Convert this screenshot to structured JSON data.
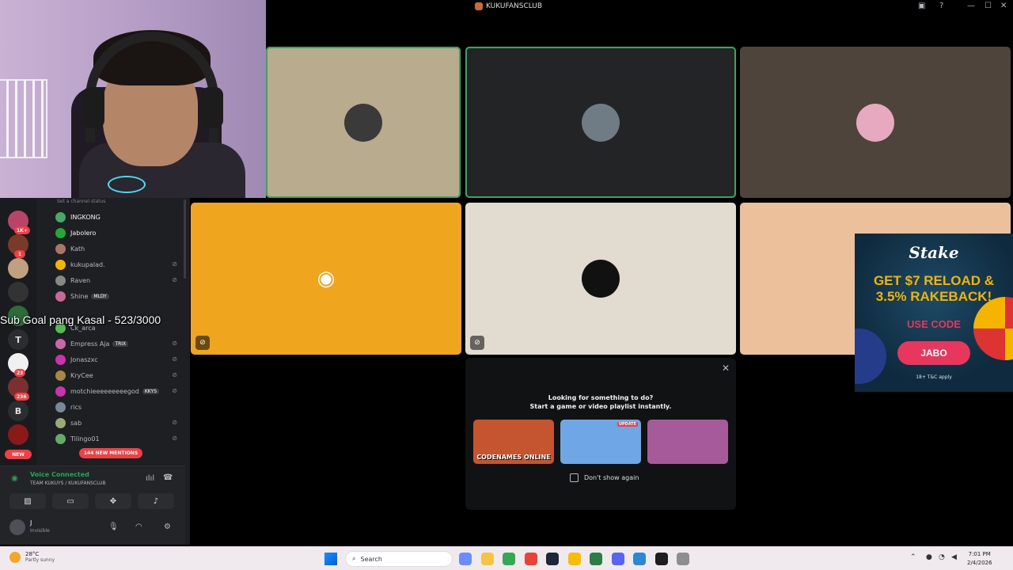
{
  "window": {
    "title": "KUKUFANSCLUB",
    "controls": {
      "minimize": "—",
      "maximize": "☐",
      "close": "✕",
      "help": "?"
    }
  },
  "stream_overlay": {
    "subgoal_text": "Sub Goal pang Kasal - 523/3000"
  },
  "guilds": [
    {
      "name": "server-1",
      "badge": "1K+"
    },
    {
      "name": "server-2",
      "badge": "1"
    },
    {
      "name": "server-3",
      "badge": ""
    },
    {
      "name": "server-4",
      "badge": ""
    },
    {
      "name": "server-5",
      "badge": ""
    },
    {
      "name": "T",
      "badge": "",
      "letter": "T"
    },
    {
      "name": "server-7",
      "badge": "23"
    },
    {
      "name": "server-8",
      "badge": "236"
    },
    {
      "name": "B",
      "badge": "",
      "letter": "B"
    },
    {
      "name": "server-10",
      "badge": ""
    }
  ],
  "new_pill": "NEW",
  "channel": {
    "status_placeholder": "Set a channel status",
    "members": [
      {
        "name": "INGKONG",
        "active": true,
        "muted": false,
        "tag": ""
      },
      {
        "name": "Jabolero",
        "active": true,
        "muted": false,
        "tag": ""
      },
      {
        "name": "Kath",
        "active": false,
        "muted": false,
        "tag": ""
      },
      {
        "name": "kukupalad.",
        "active": false,
        "muted": true,
        "tag": ""
      },
      {
        "name": "Raven",
        "active": false,
        "muted": true,
        "tag": ""
      },
      {
        "name": "Shine",
        "active": false,
        "muted": false,
        "tag": "MLDY"
      },
      {
        "name": "",
        "active": false,
        "muted": false,
        "tag": ""
      },
      {
        "name": "Ck_arca",
        "active": false,
        "muted": false,
        "tag": ""
      },
      {
        "name": "Empress Aja",
        "active": false,
        "muted": true,
        "tag": "TRIX"
      },
      {
        "name": "Jonaszxc",
        "active": false,
        "muted": true,
        "tag": ""
      },
      {
        "name": "KryCee",
        "active": false,
        "muted": true,
        "tag": ""
      },
      {
        "name": "motchieeeeeeeeegod",
        "active": false,
        "muted": true,
        "tag": "KKYS"
      },
      {
        "name": "rics",
        "active": false,
        "muted": false,
        "tag": ""
      },
      {
        "name": "sab",
        "active": false,
        "muted": true,
        "tag": ""
      },
      {
        "name": "Tilingo01",
        "active": false,
        "muted": true,
        "tag": ""
      }
    ],
    "new_mentions": "144 NEW MENTIONS"
  },
  "voice": {
    "status": "Voice Connected",
    "location": "TEAM KUKUYS / KUKUFANSCLUB"
  },
  "user": {
    "name": "J",
    "status": "Invisible"
  },
  "tiles": [
    {
      "id": "tile-1",
      "bg": "#b9ab8e",
      "speaking": true,
      "muted": false,
      "avatar": "#3a3a3a",
      "discord": false
    },
    {
      "id": "tile-2",
      "bg": "#222425",
      "speaking": true,
      "muted": false,
      "avatar": "#6f7c86",
      "discord": false
    },
    {
      "id": "tile-3",
      "bg": "#4f443b",
      "speaking": false,
      "muted": false,
      "avatar": "#e7a9c0",
      "discord": false
    },
    {
      "id": "tile-4",
      "bg": "#f0a51e",
      "speaking": false,
      "muted": true,
      "avatar": "#f0a51e",
      "discord": true
    },
    {
      "id": "tile-5",
      "bg": "#e2dbd0",
      "speaking": false,
      "muted": true,
      "avatar": "#111111",
      "discord": false
    },
    {
      "id": "tile-6",
      "bg": "#ecc09a",
      "speaking": false,
      "muted": false,
      "avatar": "",
      "discord": false
    }
  ],
  "activity": {
    "line1": "Looking for something to do?",
    "line2": "Start a game or video playlist instantly.",
    "games": [
      {
        "name": "CODENAMES ONLINE",
        "bg": "#c4552e",
        "badge": ""
      },
      {
        "name": "",
        "bg": "#6fa6e6",
        "badge": "UPDATE"
      },
      {
        "name": "",
        "bg": "#a65a9a",
        "badge": ""
      }
    ],
    "dont_show": "Don't show again",
    "close": "✕"
  },
  "ad": {
    "brand": "Stake",
    "headline_1": "GET $7 RELOAD &",
    "headline_2": "3.5% RAKEBACK!",
    "use_code": "USE CODE",
    "code": "JABO",
    "terms": "18+ T&C apply"
  },
  "taskbar": {
    "weather_temp": "28°C",
    "weather_desc": "Partly sunny",
    "search_placeholder": "Search",
    "time": "7:01 PM",
    "date": "2/4/2026",
    "apps": [
      {
        "name": "copilot",
        "color": "#6b8cff"
      },
      {
        "name": "file-explorer",
        "color": "#f5c542"
      },
      {
        "name": "chrome-1",
        "color": "#34a853"
      },
      {
        "name": "chrome-2",
        "color": "#ea4335"
      },
      {
        "name": "steam",
        "color": "#1b2838"
      },
      {
        "name": "chrome-3",
        "color": "#fbbc05"
      },
      {
        "name": "app-7",
        "color": "#2d7d46"
      },
      {
        "name": "discord",
        "color": "#5865f2"
      },
      {
        "name": "notepad",
        "color": "#2b88d8"
      },
      {
        "name": "vscode",
        "color": "#1e1e1e"
      },
      {
        "name": "snipping",
        "color": "#8e8e8e"
      }
    ]
  }
}
